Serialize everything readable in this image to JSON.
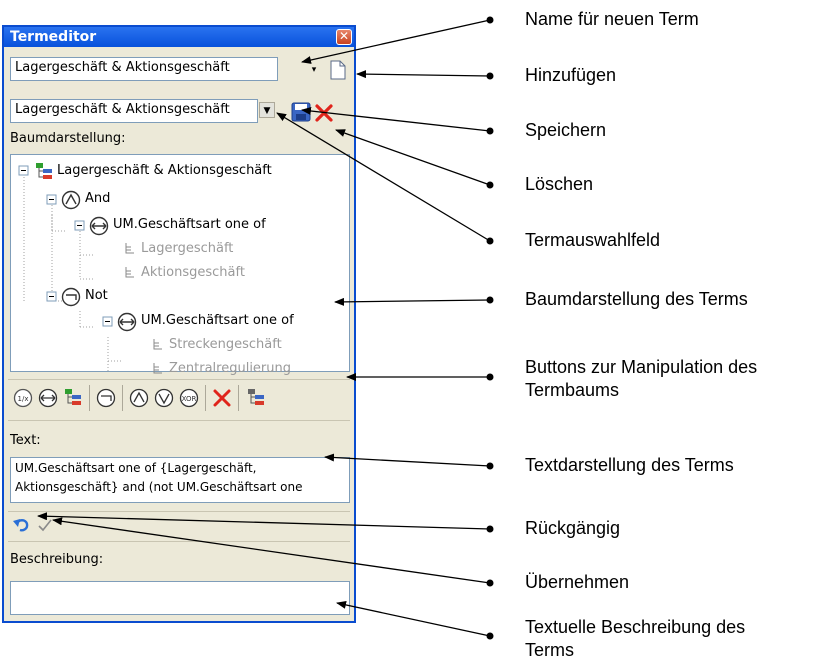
{
  "window": {
    "title": "Termeditor",
    "close_glyph": "✕"
  },
  "name_field": {
    "value": "Lagergeschäft & Aktionsgeschäft",
    "dropdown_glyph": "▾"
  },
  "term_select": {
    "value": "Lagergeschäft & Aktionsgeschäft",
    "dropdown_glyph": "▼"
  },
  "tree": {
    "label": "Baumdarstellung:",
    "nodes": [
      {
        "text": "Lagergeschäft & Aktionsgeschäft",
        "icon": "tree-root-icon"
      },
      {
        "text": "And",
        "icon": "and-operator-icon"
      },
      {
        "text": "UM.Geschäftsart one of",
        "icon": "one-of-operator-icon"
      },
      {
        "text": "Lagergeschäft",
        "icon": "value-leaf-icon"
      },
      {
        "text": "Aktionsgeschäft",
        "icon": "value-leaf-icon"
      },
      {
        "text": "Not",
        "icon": "not-operator-icon"
      },
      {
        "text": "UM.Geschäftsart one of",
        "icon": "one-of-operator-icon"
      },
      {
        "text": "Streckengeschäft",
        "icon": "value-leaf-icon"
      },
      {
        "text": "Zentralregulierung",
        "icon": "value-leaf-icon"
      }
    ]
  },
  "toolbar": {
    "buttons": [
      "is-operator-icon",
      "one-of-operator-icon",
      "add-term-icon",
      "not-operator-icon",
      "and-operator-icon",
      "or-operator-icon",
      "xor-operator-icon",
      "delete-node-icon",
      "term-tree-icon"
    ]
  },
  "text_section": {
    "label": "Text:",
    "line1": "UM.Geschäftsart one of {Lagergeschäft,",
    "line2": "Aktionsgeschäft} and (not UM.Geschäftsart one"
  },
  "beschreibung": {
    "label": "Beschreibung:",
    "value": ""
  },
  "annotations": {
    "name": "Name für neuen Term",
    "add": "Hinzufügen",
    "save": "Speichern",
    "delete": "Löschen",
    "selector": "Termauswahlfeld",
    "tree": "Baumdarstellung des Terms",
    "buttons_line1": "Buttons zur Manipulation des",
    "buttons_line2": "Termbaums",
    "text": "Textdarstellung des Terms",
    "undo": "Rückgängig",
    "apply": "Übernehmen",
    "desc_line1": "Textuelle Beschreibung des",
    "desc_line2": "Terms"
  },
  "colors": {
    "window_border": "#0a4ccf",
    "titlebar": "#2a73f0",
    "panel": "#ece9d8",
    "delete_red": "#e0241b"
  }
}
